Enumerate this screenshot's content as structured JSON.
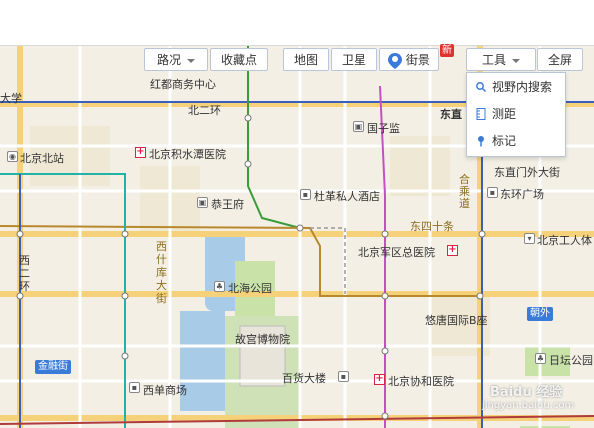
{
  "toolbar": {
    "traffic_label": "路况",
    "favorites_label": "收藏点",
    "map_label": "地图",
    "satellite_label": "卫星",
    "streetview_label": "街景",
    "new_badge": "新",
    "tools_label": "工具",
    "fullscreen_label": "全屏"
  },
  "tools_menu": {
    "items": [
      {
        "label": "视野内搜索",
        "icon": "search-icon"
      },
      {
        "label": "测距",
        "icon": "ruler-icon"
      },
      {
        "label": "标记",
        "icon": "pin-icon"
      }
    ]
  },
  "map_labels": {
    "top_left_fragment": "大学",
    "top_center_fragment": "红都商务中心",
    "north_second_ring": "北二环",
    "dongzhi": "东直",
    "guozijian": "国子监",
    "beijing_north_station": "北京北站",
    "jishuitan_hospital": "北京积水潭医院",
    "dongzhimen_outer": "东直门外大街",
    "gongjie_hotel": "杜革私人酒店",
    "dongguan_fragment": "东环广场",
    "gongwang": "恭王府",
    "dongsi_shitiao": "东四十条",
    "hechuan": "合乘道",
    "military_hospital": "北京军区总医院",
    "workers_stadium": "北京工人体",
    "xishiku": "西什库大街",
    "west_second_ring": "西二环",
    "beihai_park": "北海公园",
    "youlan": "悠唐国际B座",
    "chaowai": "朝外",
    "palace_museum": "故宫博物院",
    "jinrongjie": "金融街",
    "ritan": "日坛公园",
    "xidan": "西单商场",
    "department_store": "百货大楼",
    "xiehe_hospital": "北京协和医院",
    "dong_fragment": "东",
    "watermark": "Baidu 经验",
    "watermark_url": "jingyan.baidu.com"
  },
  "colors": {
    "road_main": "#f5d27a",
    "road_minor": "#ffffff",
    "line_green": "#3b9b3b",
    "line_teal": "#22b3a8",
    "line_magenta": "#c34fc3",
    "line_blue": "#3a5fbd",
    "line_brown": "#b8892c",
    "water": "#a8cbe8",
    "park": "#c8e2a8"
  }
}
